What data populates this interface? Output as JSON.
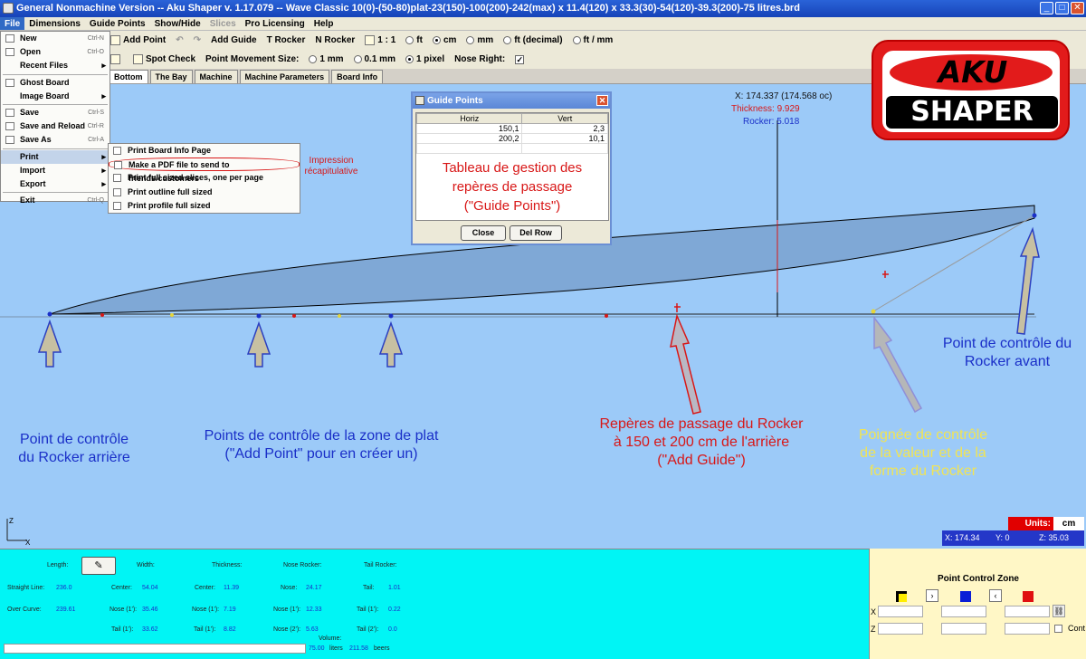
{
  "window": {
    "title": "General Nonmachine Version -- Aku Shaper v. 1.17.079  --  Wave Classic 10(0)-(50-80)plat-23(150)-100(200)-242(max) x 11.4(120) x 33.3(30)-54(120)-39.3(200)-75 litres.brd"
  },
  "menubar": [
    "File",
    "Dimensions",
    "Guide Points",
    "Show/Hide",
    "Slices",
    "Pro Licensing",
    "Help"
  ],
  "toolbar1": {
    "add_point": "Add Point",
    "add_guide": "Add Guide",
    "t_rocker": "T Rocker",
    "n_rocker": "N Rocker",
    "scale": "1 : 1",
    "units": [
      "ft",
      "cm",
      "mm",
      "ft (decimal)",
      "ft / mm"
    ],
    "selected_unit": "cm"
  },
  "toolbar2": {
    "spot_check": "Spot Check",
    "movement_label": "Point Movement Size:",
    "movement": [
      "1 mm",
      "0.1 mm",
      "1 pixel"
    ],
    "selected_movement": "1 pixel",
    "nose_right": "Nose Right:"
  },
  "tabs": [
    "Bottom",
    "The Bay",
    "Machine",
    "Machine Parameters",
    "Board Info"
  ],
  "file_menu": {
    "items": [
      {
        "label": "New",
        "shortcut": "Ctrl-N"
      },
      {
        "label": "Open",
        "shortcut": "Ctrl-O"
      },
      {
        "label": "Recent Files",
        "submenu": true
      },
      {
        "sep": true
      },
      {
        "label": "Ghost Board"
      },
      {
        "label": "Image Board",
        "submenu": true
      },
      {
        "sep": true
      },
      {
        "label": "Save",
        "shortcut": "Ctrl-S"
      },
      {
        "label": "Save and Reload",
        "shortcut": "Ctrl-R"
      },
      {
        "label": "Save As",
        "shortcut": "Ctrl-A"
      },
      {
        "sep": true
      },
      {
        "label": "Print",
        "submenu": true,
        "highlight": true
      },
      {
        "label": "Import",
        "submenu": true
      },
      {
        "label": "Export",
        "submenu": true
      },
      {
        "sep": true
      },
      {
        "label": "Exit",
        "shortcut": "Ctrl-Q"
      }
    ]
  },
  "print_submenu": [
    "Print Board Info Page",
    "Make a PDF file to send to friends/customers",
    "Print full sized slices, one per page",
    "Print outline full sized",
    "Print profile full sized"
  ],
  "dialog": {
    "title": "Guide Points",
    "columns": [
      "Horiz",
      "Vert"
    ],
    "rows": [
      [
        "150,1",
        "2,3"
      ],
      [
        "200,2",
        "10,1"
      ]
    ],
    "close": "Close",
    "del_row": "Del Row"
  },
  "readout": {
    "x": "X: 174.337 (174.568 oc)",
    "thickness": "Thickness: 9.929",
    "rocker": "Rocker: 5.018"
  },
  "logo": {
    "top": "AKU",
    "bottom": "SHAPER"
  },
  "annotations": {
    "pdf": "Impression\nrécapitulative",
    "table": "Tableau de gestion des\nrepères de passage\n(\"Guide Points\")",
    "rear": "Point de contrôle\ndu Rocker arrière",
    "flat": "Points de contrôle de la zone de plat\n(\"Add Point\" pour en créer un)",
    "guide": "Repères de passage du Rocker\nà 150 et 200 cm de l'arrière\n(\"Add Guide\")",
    "handle": "Poignée de contrôle\nde la valeur et de la\nforme du Rocker",
    "front": "Point de contrôle du\nRocker avant"
  },
  "units_box": {
    "label": "Units:",
    "value": "cm"
  },
  "coords": {
    "x": "X: 174.34",
    "y": "Y: 0",
    "z": "Z: 35.03"
  },
  "axes": {
    "z": "Z",
    "x": "X"
  },
  "info": {
    "length": "Length:",
    "width": "Width:",
    "thickness": "Thickness:",
    "nose_rocker": "Nose Rocker:",
    "tail_rocker": "Tail Rocker:",
    "straight_line": "Straight Line:",
    "straight_val": "236.0",
    "over_curve": "Over Curve:",
    "over_val": "239.61",
    "center": "Center:",
    "width_center": "54.04",
    "nose1": "Nose (1'):",
    "width_nose1": "35.46",
    "tail1": "Tail (1'):",
    "width_tail1": "33.62",
    "thick_center": "11.39",
    "thick_nose1": "7.19",
    "thick_tail1": "8.82",
    "nose": "Nose:",
    "nose_val": "24.17",
    "nose_1": "12.33",
    "nose2": "Nose (2'):",
    "nose_2": "5.63",
    "tail": "Tail:",
    "tail_val": "1.01",
    "tail_1": "0.22",
    "tail2": "Tail (2'):",
    "tail_2": "0.0",
    "volume": "Volume:",
    "vol_liters": "75.00",
    "liters": "liters",
    "vol_beers": "211.58",
    "beers": "beers"
  },
  "pcz": {
    "title": "Point Control Zone",
    "x": "X",
    "z": "Z",
    "cont": "Cont"
  },
  "colors": {
    "canvas": "#9ccaf8",
    "info": "#00f5f5",
    "pcz": "#fff7c6",
    "accent_red": "#d81717"
  }
}
